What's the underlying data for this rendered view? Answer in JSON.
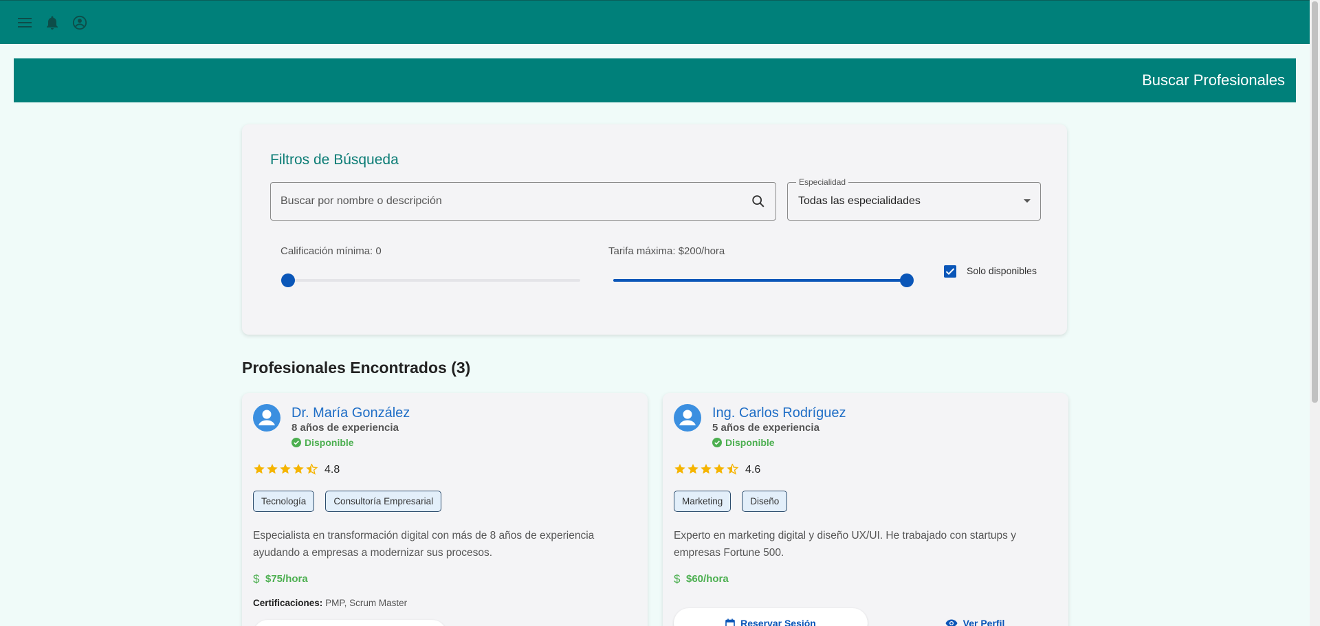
{
  "header": {
    "menu_icon": "menu-icon",
    "bell_icon": "bell-icon",
    "account_icon": "account-circle-icon"
  },
  "page_title": "Buscar Profesionales",
  "filters": {
    "title": "Filtros de Búsqueda",
    "search_placeholder": "Buscar por nombre o descripción",
    "search_value": "",
    "specialty_label": "Especialidad",
    "specialty_value": "Todas las especialidades",
    "min_rating_label": "Calificación mínima: 0",
    "min_rating_value": 0,
    "max_rate_label": "Tarifa máxima: $200/hora",
    "max_rate_value": 200,
    "only_available_label": "Solo disponibles",
    "only_available_checked": true
  },
  "results": {
    "heading": "Profesionales Encontrados (3)",
    "cards": [
      {
        "name": "Dr. María González",
        "experience": "8 años de experiencia",
        "status": "Disponible",
        "rating": "4.8",
        "tags": [
          "Tecnología",
          "Consultoría Empresarial"
        ],
        "description": "Especialista en transformación digital con más de 8 años de experiencia ayudando a empresas a modernizar sus procesos.",
        "price": "$75/hora",
        "certs_label": "Certificaciones:",
        "certs_value": "PMP, Scrum Master"
      },
      {
        "name": "Ing. Carlos Rodríguez",
        "experience": "5 años de experiencia",
        "status": "Disponible",
        "rating": "4.6",
        "tags": [
          "Marketing",
          "Diseño"
        ],
        "description": "Experto en marketing digital y diseño UX/UI. He trabajado con startups y empresas Fortune 500.",
        "price": "$60/hora",
        "reserve_label": "Reservar Sesión",
        "view_label": "Ver Perfil"
      }
    ]
  },
  "colors": {
    "primary": "#00807a",
    "accent": "#0a56b8",
    "success": "#4caf50",
    "link": "#1f6ec6",
    "star": "#f5b400"
  }
}
